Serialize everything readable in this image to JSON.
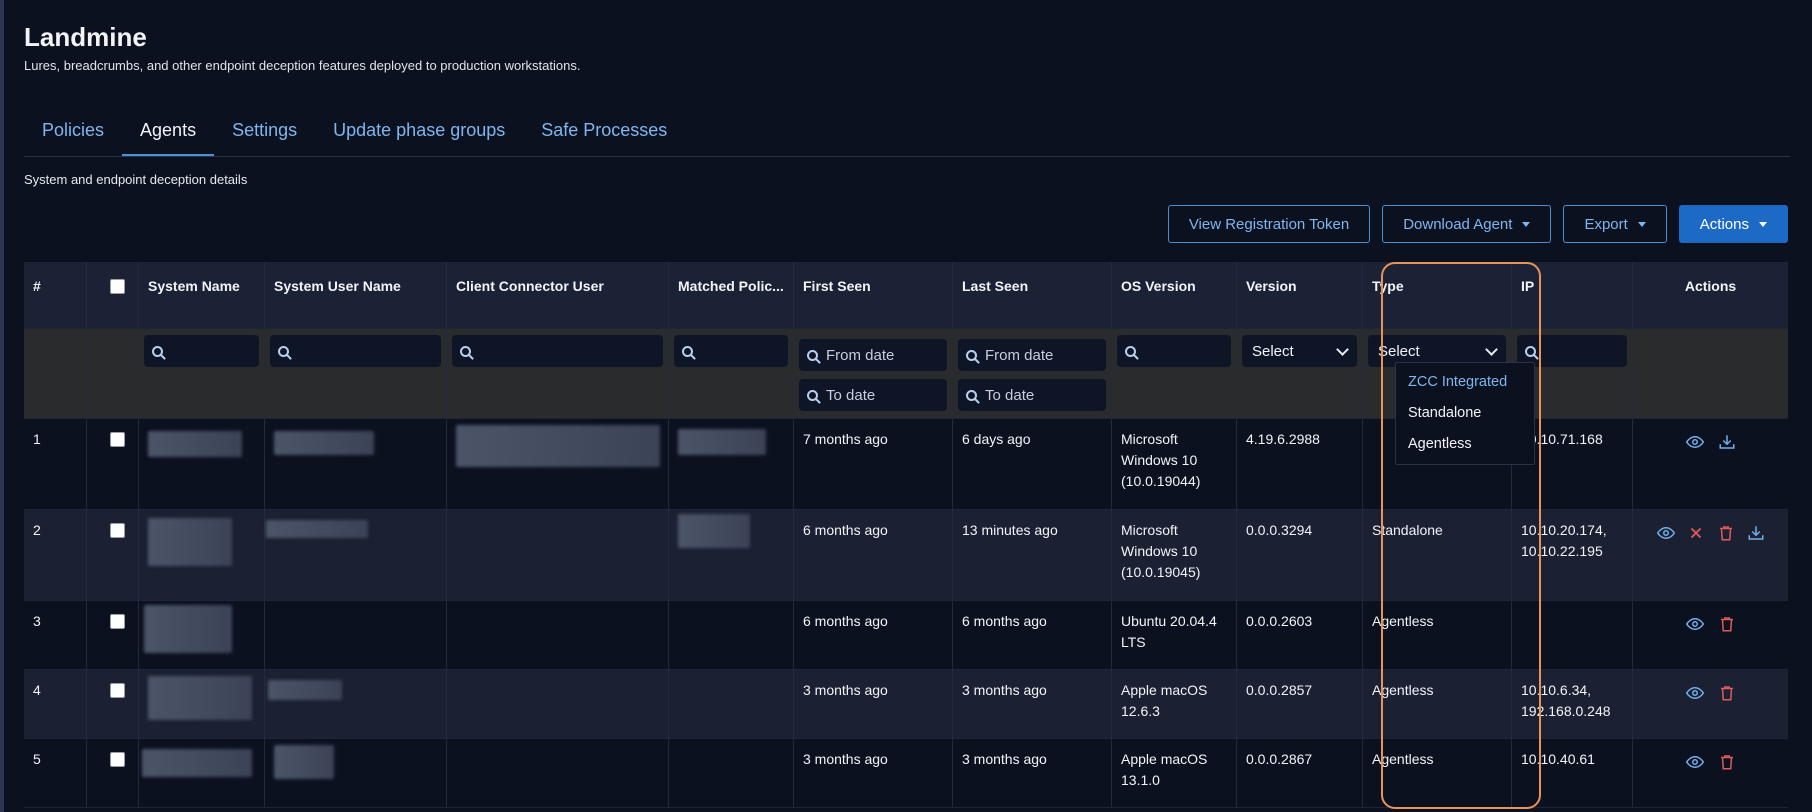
{
  "app": {
    "title": "Landmine",
    "subtitle": "Lures, breadcrumbs, and other endpoint deception features deployed to production workstations."
  },
  "tabs": [
    {
      "label": "Policies"
    },
    {
      "label": "Agents",
      "active": true
    },
    {
      "label": "Settings"
    },
    {
      "label": "Update phase groups"
    },
    {
      "label": "Safe Processes"
    }
  ],
  "section": {
    "subtitle": "System and endpoint deception details"
  },
  "toolbar": {
    "view_token": "View Registration Token",
    "download_agent": "Download Agent",
    "export": "Export",
    "actions": "Actions"
  },
  "table": {
    "columns": [
      "#",
      "",
      "System Name",
      "System User Name",
      "Client Connector User",
      "Matched Polic...",
      "First Seen",
      "Last Seen",
      "OS Version",
      "Version",
      "Type",
      "IP",
      "Actions"
    ],
    "filters": {
      "from_date": "From date",
      "to_date": "To date",
      "version_select": "Select",
      "type_select": "Select"
    },
    "rows": [
      {
        "num": "1",
        "first_seen": "7 months ago",
        "last_seen": "6 days ago",
        "os": "Microsoft Windows 10 (10.0.19044)",
        "version": "4.19.6.2988",
        "type": "",
        "ip": "10.10.71.168"
      },
      {
        "num": "2",
        "first_seen": "6 months ago",
        "last_seen": "13 minutes ago",
        "os": "Microsoft Windows 10 (10.0.19045)",
        "version": "0.0.0.3294",
        "type": "Standalone",
        "ip": "10.10.20.174, 10.10.22.195"
      },
      {
        "num": "3",
        "first_seen": "6 months ago",
        "last_seen": "6 months ago",
        "os": "Ubuntu 20.04.4 LTS",
        "version": "0.0.0.2603",
        "type": "Agentless",
        "ip": ""
      },
      {
        "num": "4",
        "first_seen": "3 months ago",
        "last_seen": "3 months ago",
        "os": "Apple macOS 12.6.3",
        "version": "0.0.0.2857",
        "type": "Agentless",
        "ip": "10.10.6.34, 192.168.0.248"
      },
      {
        "num": "5",
        "first_seen": "3 months ago",
        "last_seen": "3 months ago",
        "os": "Apple macOS 13.1.0",
        "version": "0.0.0.2867",
        "type": "Agentless",
        "ip": "10.10.40.61"
      }
    ]
  },
  "type_dropdown": {
    "options": [
      "ZCC Integrated",
      "Standalone",
      "Agentless"
    ]
  },
  "colors": {
    "accent": "#7fb6ef",
    "primary_button": "#1c6ac6",
    "highlight": "#e8935a",
    "delete": "#e05a5a"
  }
}
